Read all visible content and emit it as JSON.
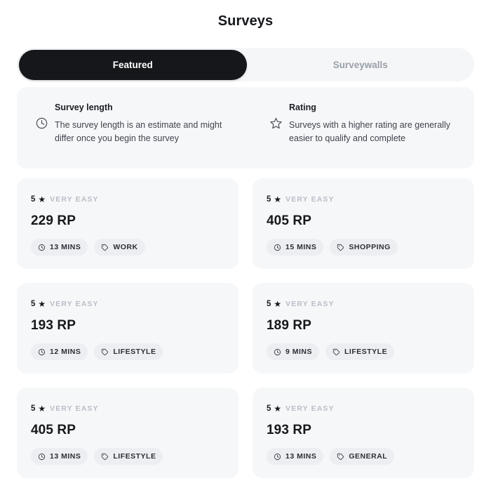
{
  "header": {
    "title": "Surveys"
  },
  "tabs": [
    {
      "label": "Featured",
      "active": true
    },
    {
      "label": "Surveywalls",
      "active": false
    }
  ],
  "info_banner": {
    "items": [
      {
        "icon": "clock-icon",
        "heading": "Survey length",
        "body": "The survey length is an estimate and might differ once you begin the survey"
      },
      {
        "icon": "star-icon",
        "heading": "Rating",
        "body": "Surveys with a higher rating are generally easier to qualify and complete"
      }
    ]
  },
  "surveys": [
    {
      "rating_value": "5",
      "rating_star": "★",
      "rating_label": "VERY EASY",
      "reward": "229 RP",
      "duration": "13 MINS",
      "category": "WORK"
    },
    {
      "rating_value": "5",
      "rating_star": "★",
      "rating_label": "VERY EASY",
      "reward": "405 RP",
      "duration": "15 MINS",
      "category": "SHOPPING"
    },
    {
      "rating_value": "5",
      "rating_star": "★",
      "rating_label": "VERY EASY",
      "reward": "193 RP",
      "duration": "12 MINS",
      "category": "LIFESTYLE"
    },
    {
      "rating_value": "5",
      "rating_star": "★",
      "rating_label": "VERY EASY",
      "reward": "189 RP",
      "duration": "9 MINS",
      "category": "LIFESTYLE"
    },
    {
      "rating_value": "5",
      "rating_star": "★",
      "rating_label": "VERY EASY",
      "reward": "405 RP",
      "duration": "13 MINS",
      "category": "LIFESTYLE"
    },
    {
      "rating_value": "5",
      "rating_star": "★",
      "rating_label": "VERY EASY",
      "reward": "193 RP",
      "duration": "13 MINS",
      "category": "GENERAL"
    }
  ],
  "colors": {
    "page_background": "#ffffff",
    "card_background": "#f6f7f9",
    "pill_background": "#eceef1",
    "tab_active_background": "#15171b",
    "tab_active_text": "#ffffff",
    "tab_inactive_text": "#9aa0a8",
    "text_primary": "#16181c",
    "text_muted": "#b9bec6"
  }
}
